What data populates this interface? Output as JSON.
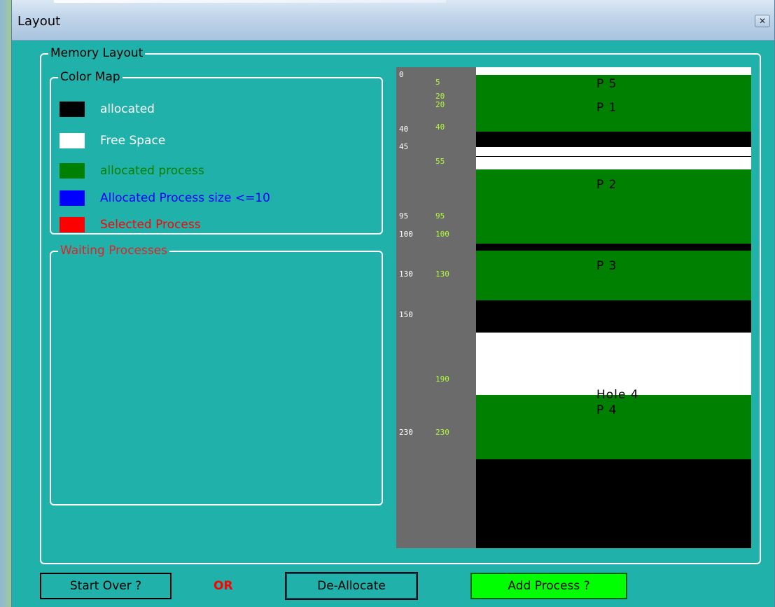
{
  "window": {
    "title": "Layout",
    "close_glyph": "✕"
  },
  "memory_layout": {
    "label": "Memory Layout"
  },
  "color_map": {
    "label": "Color Map",
    "items": [
      {
        "label": "allocated",
        "swatch": "#000000",
        "text_color": "#ffffff"
      },
      {
        "label": "Free Space",
        "swatch": "#ffffff",
        "text_color": "#ffffff"
      },
      {
        "label": "allocated process",
        "swatch": "#008000",
        "text_color": "#008000"
      },
      {
        "label": "Allocated Process size <=10",
        "swatch": "#0000ff",
        "text_color": "#0000ff"
      },
      {
        "label": "Selected Process",
        "swatch": "#ff0000",
        "text_color": "#ff0000"
      }
    ]
  },
  "waiting": {
    "label": "Waiting Processes"
  },
  "memory": {
    "total": 254,
    "ruler_white": [
      "0",
      "40",
      "45",
      "95",
      "100",
      "130",
      "150",
      "230"
    ],
    "ruler_green": [
      "5",
      "20",
      "20",
      "40",
      "55",
      "95",
      "100",
      "130",
      "190",
      "230"
    ],
    "segments": [
      {
        "start": 0,
        "end": 4,
        "color": "#ffffff",
        "label": ""
      },
      {
        "start": 4,
        "end": 33,
        "color": "#008000",
        "label": "P 5"
      },
      {
        "start": 33,
        "end": 34,
        "color": "#008000",
        "label": "P 1"
      },
      {
        "start": 34,
        "end": 42,
        "color": "#000000",
        "label": ""
      },
      {
        "start": 42,
        "end": 47,
        "color": "#ffffff",
        "label": ""
      },
      {
        "start": 47,
        "end": 47,
        "color": "#ffffff",
        "label": ""
      },
      {
        "start": 47,
        "end": 47.5,
        "color": "#000000",
        "label": ""
      },
      {
        "start": 47.5,
        "end": 54,
        "color": "#ffffff",
        "label": ""
      },
      {
        "start": 54,
        "end": 93,
        "color": "#008000",
        "label": "P 2"
      },
      {
        "start": 93,
        "end": 97,
        "color": "#000000",
        "label": ""
      },
      {
        "start": 97,
        "end": 123,
        "color": "#008000",
        "label": "P 3"
      },
      {
        "start": 123,
        "end": 140,
        "color": "#000000",
        "label": ""
      },
      {
        "start": 140,
        "end": 173,
        "color": "#ffffff",
        "label": "Hole 4"
      },
      {
        "start": 173,
        "end": 207,
        "color": "#008000",
        "label": "P 4"
      },
      {
        "start": 207,
        "end": 254,
        "color": "#000000",
        "label": ""
      }
    ]
  },
  "buttons": {
    "start_over": "Start Over ?",
    "or": "OR",
    "deallocate": "De-Allocate",
    "add_process": "Add Process ?"
  }
}
